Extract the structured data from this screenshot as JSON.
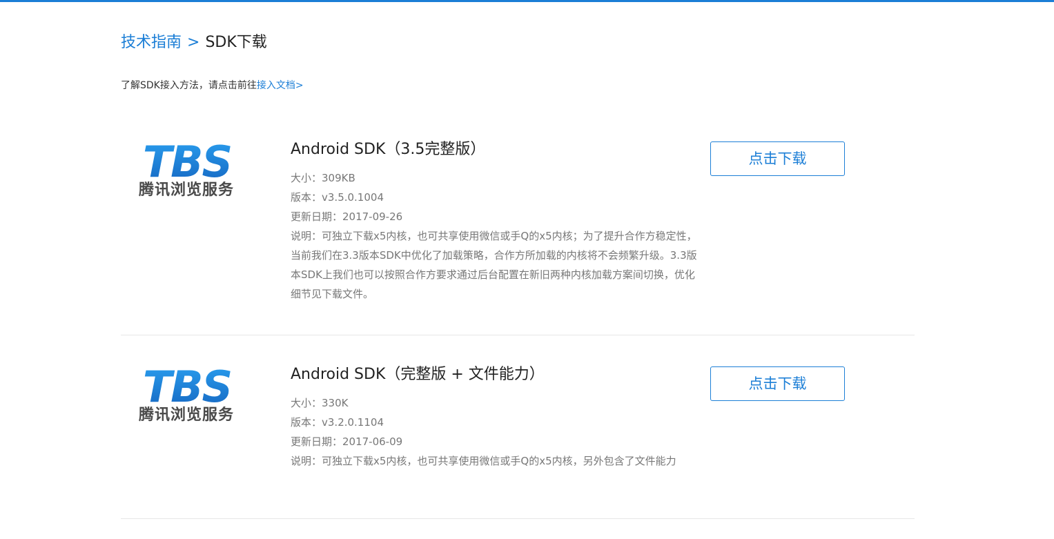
{
  "breadcrumb": {
    "parent": "技术指南",
    "separator": ">",
    "current": "SDK下载"
  },
  "intro": {
    "text": "了解SDK接入方法，请点击前往",
    "link": "接入文档>"
  },
  "colors": {
    "accent": "#1b7ed6",
    "logo_gradient_start": "#1a8fe8",
    "logo_gradient_end": "#1565c0"
  },
  "sdk_items": [
    {
      "logo_mark": "TBS",
      "logo_text": "腾讯浏览服务",
      "title": "Android SDK（3.5完整版）",
      "size": "大小：309KB",
      "version": "版本：v3.5.0.1004",
      "updated": "更新日期：2017-09-26",
      "description": "说明：可独立下载x5内核，也可共享使用微信或手Q的x5内核；为了提升合作方稳定性，当前我们在3.3版本SDK中优化了加载策略，合作方所加载的内核将不会频繁升级。3.3版本SDK上我们也可以按照合作方要求通过后台配置在新旧两种内核加载方案间切换，优化细节见下载文件。",
      "button": "点击下载"
    },
    {
      "logo_mark": "TBS",
      "logo_text": "腾讯浏览服务",
      "title": "Android SDK（完整版 + 文件能力）",
      "size": "大小：330K",
      "version": "版本：v3.2.0.1104",
      "updated": "更新日期：2017-06-09",
      "description": "说明：可独立下载x5内核，也可共享使用微信或手Q的x5内核，另外包含了文件能力",
      "button": "点击下载"
    }
  ]
}
